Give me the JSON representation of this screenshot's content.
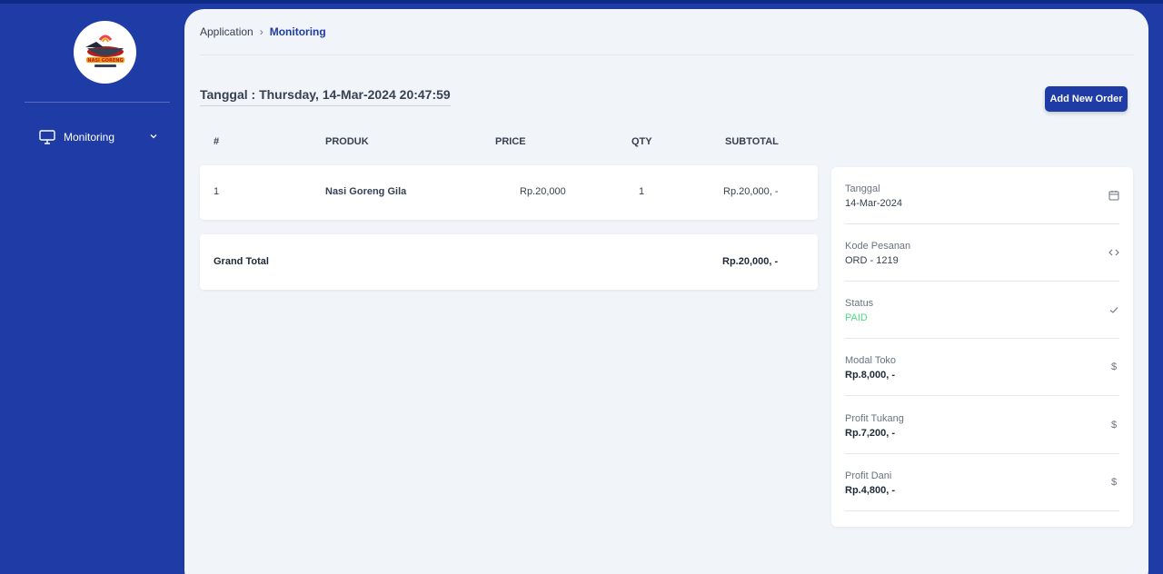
{
  "sidebar": {
    "nav": [
      {
        "label": "Monitoring",
        "icon": "monitor-icon"
      }
    ],
    "logo_text": "NASI GORENG"
  },
  "breadcrumb": {
    "parent": "Application",
    "separator": "›",
    "current": "Monitoring"
  },
  "header": {
    "date_title": "Tanggal : Thursday, 14-Mar-2024 20:47:59",
    "add_button": "Add New Order"
  },
  "table": {
    "columns": [
      "#",
      "PRODUK",
      "PRICE",
      "QTY",
      "SUBTOTAL"
    ],
    "rows": [
      {
        "no": "1",
        "produk": "Nasi Goreng Gila",
        "price": "Rp.20,000",
        "qty": "1",
        "subtotal": "Rp.20,000, -"
      }
    ],
    "grand_total_label": "Grand Total",
    "grand_total_value": "Rp.20,000, -"
  },
  "details": [
    {
      "label": "Tanggal",
      "value": "14-Mar-2024",
      "icon": "calendar-icon"
    },
    {
      "label": "Kode Pesanan",
      "value": "ORD - 1219",
      "icon": "code-icon"
    },
    {
      "label": "Status",
      "value": "PAID",
      "icon": "check-icon"
    },
    {
      "label": "Modal Toko",
      "value": "Rp.8,000, -",
      "icon": "dollar-icon"
    },
    {
      "label": "Profit Tukang",
      "value": "Rp.7,200, -",
      "icon": "dollar-icon"
    },
    {
      "label": "Profit Dani",
      "value": "Rp.4,800, -",
      "icon": "dollar-icon"
    }
  ],
  "colors": {
    "brand": "#1e3ba6",
    "background": "#f1f5f9",
    "paid": "#4ade80"
  }
}
